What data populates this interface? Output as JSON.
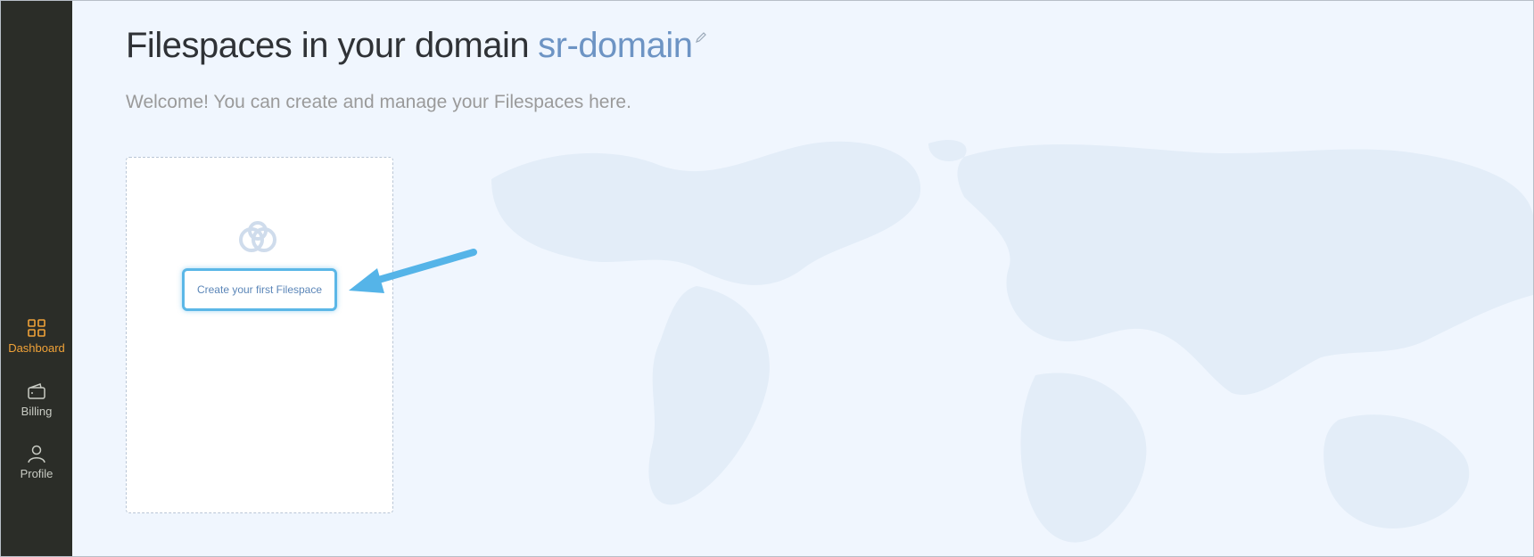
{
  "sidebar": {
    "items": [
      {
        "label": "Dashboard",
        "icon": "grid-icon",
        "active": true
      },
      {
        "label": "Billing",
        "icon": "wallet-icon",
        "active": false
      },
      {
        "label": "Profile",
        "icon": "user-icon",
        "active": false
      }
    ]
  },
  "header": {
    "title": "Filespaces in your domain",
    "domain": "sr-domain",
    "subtitle": "Welcome! You can create and manage your Filespaces here."
  },
  "card": {
    "logo_icon": "cloud-link-icon",
    "create_button_label": "Create your first Filespace"
  },
  "colors": {
    "sidebar_bg": "#2b2d28",
    "active_nav": "#f0a238",
    "accent_blue": "#5bb7e7",
    "domain_text": "#6d94c4",
    "page_bg": "#f0f6fe"
  }
}
